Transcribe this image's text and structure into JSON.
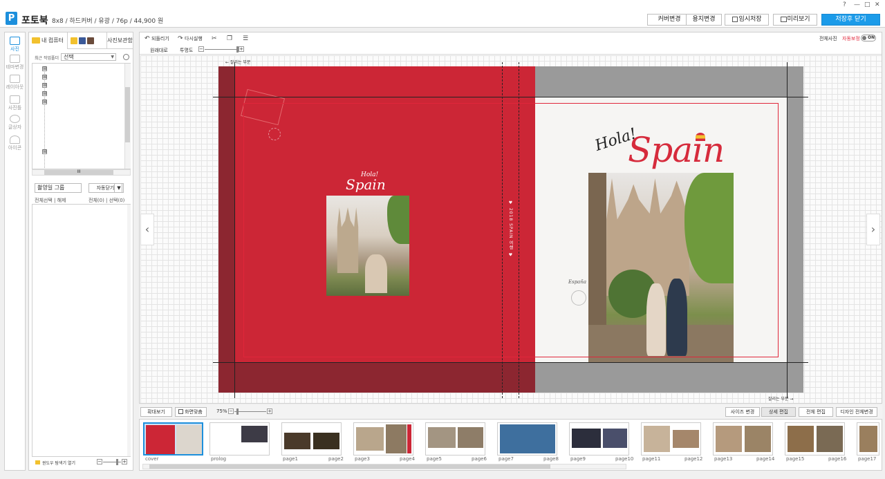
{
  "app": {
    "logo": "P",
    "title": "포토북",
    "spec": "8x8 / 하드커버 / 유광 / 76p / 44,900 원",
    "window_controls": [
      "?",
      "—",
      "□",
      "✕"
    ]
  },
  "header_buttons": {
    "cover_change": "커버변경",
    "paper_change": "용지변경",
    "temp_save": "임시저장",
    "preview": "미리보기",
    "save_close": "저장후 닫기"
  },
  "rail": {
    "items": [
      {
        "label": "사진",
        "icon": "photo-icon"
      },
      {
        "label": "테마변경",
        "icon": "theme-icon"
      },
      {
        "label": "레이아웃",
        "icon": "layout-icon"
      },
      {
        "label": "사진틀",
        "icon": "frame-icon"
      },
      {
        "label": "글상자",
        "icon": "textbox-icon"
      },
      {
        "label": "아이콘",
        "icon": "heart-icon"
      }
    ]
  },
  "left_panel": {
    "tab_mycomputer": "내 컴퓨터",
    "tab_photomgr": "사진보관함",
    "recent_label": "최근 작업폴더",
    "recent_value": "선택",
    "tree_expanders": [
      "⊞",
      "⊞",
      "⊞",
      "⊞",
      "⊞",
      "⊞"
    ],
    "scroll_grip": "III",
    "group_value": "촬영일 그룹",
    "auto_close": "자동닫기",
    "select_all": "전체선택 | 해제",
    "counts": "전체(0) | 선택(0)",
    "open_explorer": "윈도우 탐색기 열기"
  },
  "toolbar": {
    "undo": "되돌리기",
    "redo": "다시실행",
    "original_size": "원래대로",
    "opacity": "투명도",
    "all_photos": "전체사진",
    "autocorrect": "자동보정",
    "toggle": "ON"
  },
  "canvas": {
    "cut_top": "← 잘리는 부분",
    "cut_bottom": "잘리는 부분 →",
    "small_hola": "Hola!",
    "small_spain": "Spain",
    "spine_text": "♥ 2018 SPAIN 여행 ♥",
    "big_hola": "Hola!",
    "big_spain": "Spain",
    "espana": "España",
    "nav_prev": "‹",
    "nav_next": "›"
  },
  "bottom": {
    "zoom_in": "확대보기",
    "fit": "화면맞춤",
    "zoom_pct": "75%",
    "size_change": "사이즈 변경",
    "detail_edit": "상세 편집",
    "all_edit": "전체 편집",
    "design_all_change": "디자인 전체변경"
  },
  "thumbnails": [
    {
      "left": "cover",
      "right": "",
      "selected": true
    },
    {
      "left": "prolog",
      "right": "",
      "selected": false
    },
    {
      "left": "page1",
      "right": "page2",
      "selected": false
    },
    {
      "left": "page3",
      "right": "page4",
      "selected": false
    },
    {
      "left": "page5",
      "right": "page6",
      "selected": false
    },
    {
      "left": "page7",
      "right": "page8",
      "selected": false
    },
    {
      "left": "page9",
      "right": "page10",
      "selected": false
    },
    {
      "left": "page11",
      "right": "page12",
      "selected": false
    },
    {
      "left": "page13",
      "right": "page14",
      "selected": false
    },
    {
      "left": "page15",
      "right": "page16",
      "selected": false
    },
    {
      "left": "page17",
      "right": "",
      "selected": false
    }
  ],
  "colors": {
    "accent": "#1b9be9",
    "cover_red": "#cc2636",
    "cover_dark": "#8c2630",
    "autocorrect_red": "#e0263a"
  }
}
